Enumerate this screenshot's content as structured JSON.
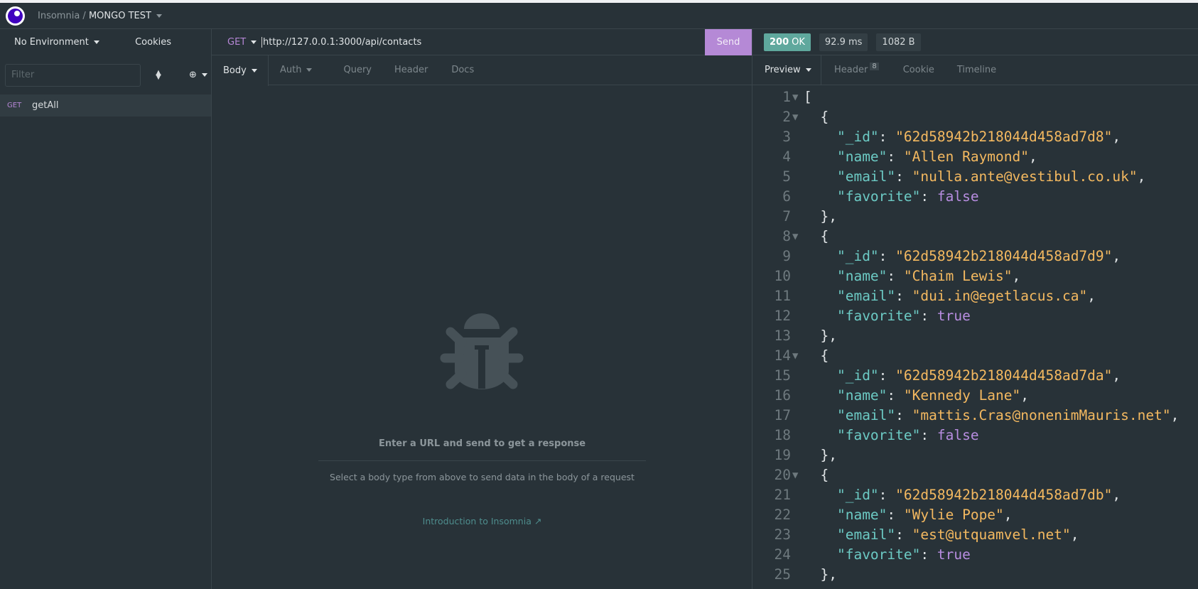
{
  "titlebar": {
    "app": "Insomnia",
    "separator": "/",
    "workspace": "MONGO TEST"
  },
  "sidebar": {
    "environment": "No Environment",
    "cookies": "Cookies",
    "filter_placeholder": "Filter",
    "filter_value": "",
    "requests": [
      {
        "method": "GET",
        "name": "getAll"
      }
    ]
  },
  "request": {
    "method": "GET",
    "url": "http://127.0.0.1:3000/api/contacts",
    "send": "Send",
    "tabs": [
      {
        "label": "Body",
        "active": true
      },
      {
        "label": "Auth"
      },
      {
        "label": "Query"
      },
      {
        "label": "Header"
      },
      {
        "label": "Docs"
      }
    ],
    "empty": {
      "title": "Enter a URL and send to get a response",
      "subtitle": "Select a body type from above to send data in the body of a request",
      "link": "Introduction to Insomnia"
    }
  },
  "response": {
    "status_code": "200",
    "status_text": "OK",
    "time": "92.9 ms",
    "size": "1082 B",
    "tabs": [
      {
        "label": "Preview",
        "active": true
      },
      {
        "label": "Header",
        "count": "8"
      },
      {
        "label": "Cookie"
      },
      {
        "label": "Timeline"
      }
    ],
    "lines": [
      {
        "n": "1",
        "fold": true,
        "toks": [
          [
            "p",
            "["
          ]
        ]
      },
      {
        "n": "2",
        "fold": true,
        "toks": [
          [
            "p",
            "  {"
          ]
        ]
      },
      {
        "n": "3",
        "toks": [
          [
            "p",
            "    "
          ],
          [
            "k",
            "\"_id\""
          ],
          [
            "p",
            ": "
          ],
          [
            "s",
            "\"62d58942b218044d458ad7d8\""
          ],
          [
            "p",
            ","
          ]
        ]
      },
      {
        "n": "4",
        "toks": [
          [
            "p",
            "    "
          ],
          [
            "k",
            "\"name\""
          ],
          [
            "p",
            ": "
          ],
          [
            "s",
            "\"Allen Raymond\""
          ],
          [
            "p",
            ","
          ]
        ]
      },
      {
        "n": "5",
        "toks": [
          [
            "p",
            "    "
          ],
          [
            "k",
            "\"email\""
          ],
          [
            "p",
            ": "
          ],
          [
            "s",
            "\"nulla.ante@vestibul.co.uk\""
          ],
          [
            "p",
            ","
          ]
        ]
      },
      {
        "n": "6",
        "toks": [
          [
            "p",
            "    "
          ],
          [
            "k",
            "\"favorite\""
          ],
          [
            "p",
            ": "
          ],
          [
            "b",
            "false"
          ]
        ]
      },
      {
        "n": "7",
        "toks": [
          [
            "p",
            "  },"
          ]
        ]
      },
      {
        "n": "8",
        "fold": true,
        "toks": [
          [
            "p",
            "  {"
          ]
        ]
      },
      {
        "n": "9",
        "toks": [
          [
            "p",
            "    "
          ],
          [
            "k",
            "\"_id\""
          ],
          [
            "p",
            ": "
          ],
          [
            "s",
            "\"62d58942b218044d458ad7d9\""
          ],
          [
            "p",
            ","
          ]
        ]
      },
      {
        "n": "10",
        "toks": [
          [
            "p",
            "    "
          ],
          [
            "k",
            "\"name\""
          ],
          [
            "p",
            ": "
          ],
          [
            "s",
            "\"Chaim Lewis\""
          ],
          [
            "p",
            ","
          ]
        ]
      },
      {
        "n": "11",
        "toks": [
          [
            "p",
            "    "
          ],
          [
            "k",
            "\"email\""
          ],
          [
            "p",
            ": "
          ],
          [
            "s",
            "\"dui.in@egetlacus.ca\""
          ],
          [
            "p",
            ","
          ]
        ]
      },
      {
        "n": "12",
        "toks": [
          [
            "p",
            "    "
          ],
          [
            "k",
            "\"favorite\""
          ],
          [
            "p",
            ": "
          ],
          [
            "b",
            "true"
          ]
        ]
      },
      {
        "n": "13",
        "toks": [
          [
            "p",
            "  },"
          ]
        ]
      },
      {
        "n": "14",
        "fold": true,
        "toks": [
          [
            "p",
            "  {"
          ]
        ]
      },
      {
        "n": "15",
        "toks": [
          [
            "p",
            "    "
          ],
          [
            "k",
            "\"_id\""
          ],
          [
            "p",
            ": "
          ],
          [
            "s",
            "\"62d58942b218044d458ad7da\""
          ],
          [
            "p",
            ","
          ]
        ]
      },
      {
        "n": "16",
        "toks": [
          [
            "p",
            "    "
          ],
          [
            "k",
            "\"name\""
          ],
          [
            "p",
            ": "
          ],
          [
            "s",
            "\"Kennedy Lane\""
          ],
          [
            "p",
            ","
          ]
        ]
      },
      {
        "n": "17",
        "toks": [
          [
            "p",
            "    "
          ],
          [
            "k",
            "\"email\""
          ],
          [
            "p",
            ": "
          ],
          [
            "s",
            "\"mattis.Cras@nonenimMauris.net\""
          ],
          [
            "p",
            ","
          ]
        ]
      },
      {
        "n": "18",
        "toks": [
          [
            "p",
            "    "
          ],
          [
            "k",
            "\"favorite\""
          ],
          [
            "p",
            ": "
          ],
          [
            "b",
            "false"
          ]
        ]
      },
      {
        "n": "19",
        "toks": [
          [
            "p",
            "  },"
          ]
        ]
      },
      {
        "n": "20",
        "fold": true,
        "toks": [
          [
            "p",
            "  {"
          ]
        ]
      },
      {
        "n": "21",
        "toks": [
          [
            "p",
            "    "
          ],
          [
            "k",
            "\"_id\""
          ],
          [
            "p",
            ": "
          ],
          [
            "s",
            "\"62d58942b218044d458ad7db\""
          ],
          [
            "p",
            ","
          ]
        ]
      },
      {
        "n": "22",
        "toks": [
          [
            "p",
            "    "
          ],
          [
            "k",
            "\"name\""
          ],
          [
            "p",
            ": "
          ],
          [
            "s",
            "\"Wylie Pope\""
          ],
          [
            "p",
            ","
          ]
        ]
      },
      {
        "n": "23",
        "toks": [
          [
            "p",
            "    "
          ],
          [
            "k",
            "\"email\""
          ],
          [
            "p",
            ": "
          ],
          [
            "s",
            "\"est@utquamvel.net\""
          ],
          [
            "p",
            ","
          ]
        ]
      },
      {
        "n": "24",
        "toks": [
          [
            "p",
            "    "
          ],
          [
            "k",
            "\"favorite\""
          ],
          [
            "p",
            ": "
          ],
          [
            "b",
            "true"
          ]
        ]
      },
      {
        "n": "25",
        "toks": [
          [
            "p",
            "  },"
          ]
        ]
      }
    ]
  },
  "colors": {
    "background": "#283238",
    "accent": "#b589d6",
    "status_ok": "#5fa89d",
    "json_key": "#6ccac4",
    "json_string": "#f4b960",
    "json_boolean": "#b78de0"
  }
}
